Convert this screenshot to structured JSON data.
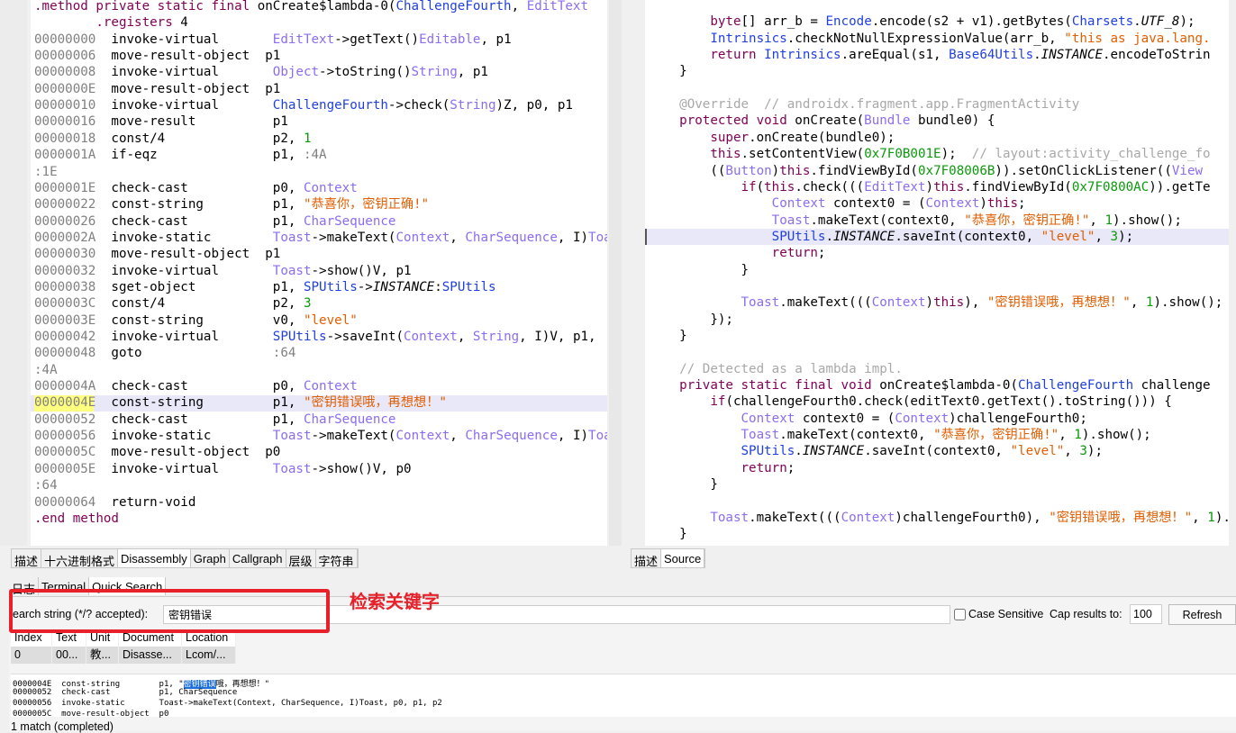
{
  "left_code": [
    [
      [
        ".method private static final ",
        "kw"
      ],
      [
        "onCreate$lambda-0(",
        ""
      ],
      [
        "ChallengeFourth",
        "ty"
      ],
      [
        ", ",
        ""
      ],
      [
        "EditText",
        "ty2"
      ]
    ],
    [
      [
        "        .registers ",
        "kw"
      ],
      [
        "4",
        ""
      ]
    ],
    [
      [
        "00000000  ",
        "addr"
      ],
      [
        "invoke-virtual       ",
        ""
      ],
      [
        "EditText",
        "ty2"
      ],
      [
        "->getText()",
        ""
      ],
      [
        "Editable",
        "ty2"
      ],
      [
        ", p1",
        ""
      ]
    ],
    [
      [
        "00000006  ",
        "addr"
      ],
      [
        "move-result-object  p1",
        ""
      ]
    ],
    [
      [
        "00000008  ",
        "addr"
      ],
      [
        "invoke-virtual       ",
        ""
      ],
      [
        "Object",
        "ty2"
      ],
      [
        "->toString()",
        ""
      ],
      [
        "String",
        "ty2"
      ],
      [
        ", p1",
        ""
      ]
    ],
    [
      [
        "0000000E  ",
        "addr"
      ],
      [
        "move-result-object  p1",
        ""
      ]
    ],
    [
      [
        "00000010  ",
        "addr"
      ],
      [
        "invoke-virtual       ",
        ""
      ],
      [
        "ChallengeFourth",
        "ty"
      ],
      [
        "->check(",
        ""
      ],
      [
        "String",
        "ty2"
      ],
      [
        ")Z, p0, p1",
        ""
      ]
    ],
    [
      [
        "00000016  ",
        "addr"
      ],
      [
        "move-result          p1",
        ""
      ]
    ],
    [
      [
        "00000018  ",
        "addr"
      ],
      [
        "const/4              p2, ",
        ""
      ],
      [
        "1",
        "num"
      ]
    ],
    [
      [
        "0000001A  ",
        "addr"
      ],
      [
        "if-eqz               p1, ",
        ""
      ],
      [
        ":4A",
        "lbl"
      ]
    ],
    [
      [
        ":1E",
        "lbl"
      ]
    ],
    [
      [
        "0000001E  ",
        "addr"
      ],
      [
        "check-cast           p0, ",
        ""
      ],
      [
        "Context",
        "ty2"
      ]
    ],
    [
      [
        "00000022  ",
        "addr"
      ],
      [
        "const-string         p1, ",
        ""
      ],
      [
        "\"恭喜你，密钥正确!\"",
        "str"
      ]
    ],
    [
      [
        "00000026  ",
        "addr"
      ],
      [
        "check-cast           p1, ",
        ""
      ],
      [
        "CharSequence",
        "ty2"
      ]
    ],
    [
      [
        "0000002A  ",
        "addr"
      ],
      [
        "invoke-static        ",
        ""
      ],
      [
        "Toast",
        "ty2"
      ],
      [
        "->makeText(",
        ""
      ],
      [
        "Context",
        "ty2"
      ],
      [
        ", ",
        ""
      ],
      [
        "CharSequence",
        "ty2"
      ],
      [
        ", I)",
        ""
      ],
      [
        "Toast",
        "ty2"
      ]
    ],
    [
      [
        "00000030  ",
        "addr"
      ],
      [
        "move-result-object  p1",
        ""
      ]
    ],
    [
      [
        "00000032  ",
        "addr"
      ],
      [
        "invoke-virtual       ",
        ""
      ],
      [
        "Toast",
        "ty2"
      ],
      [
        "->show()V, p1",
        ""
      ]
    ],
    [
      [
        "00000038  ",
        "addr"
      ],
      [
        "sget-object          p1, ",
        ""
      ],
      [
        "SPUtils",
        "ty"
      ],
      [
        "->",
        ""
      ],
      [
        "INSTANCE",
        "it"
      ],
      [
        ":",
        ""
      ],
      [
        "SPUtils",
        "ty"
      ]
    ],
    [
      [
        "0000003C  ",
        "addr"
      ],
      [
        "const/4              p2, ",
        ""
      ],
      [
        "3",
        "num"
      ]
    ],
    [
      [
        "0000003E  ",
        "addr"
      ],
      [
        "const-string         v0, ",
        ""
      ],
      [
        "\"level\"",
        "str"
      ]
    ],
    [
      [
        "00000042  ",
        "addr"
      ],
      [
        "invoke-virtual       ",
        ""
      ],
      [
        "SPUtils",
        "ty"
      ],
      [
        "->saveInt(",
        ""
      ],
      [
        "Context",
        "ty2"
      ],
      [
        ", ",
        ""
      ],
      [
        "String",
        "ty2"
      ],
      [
        ", I)V, p1,",
        ""
      ]
    ],
    [
      [
        "00000048  ",
        "addr"
      ],
      [
        "goto                 ",
        ""
      ],
      [
        ":64",
        "lbl"
      ]
    ],
    [
      [
        ":4A",
        "lbl"
      ]
    ],
    [
      [
        "0000004A  ",
        "addr"
      ],
      [
        "check-cast           p0, ",
        ""
      ],
      [
        "Context",
        "ty2"
      ]
    ],
    [
      [
        "0000004E  ",
        "addr"
      ],
      [
        "const-string         p1, ",
        ""
      ],
      [
        "\"密钥错误哦，再想想！\"",
        "str"
      ]
    ],
    [
      [
        "00000052  ",
        "addr"
      ],
      [
        "check-cast           p1, ",
        ""
      ],
      [
        "CharSequence",
        "ty2"
      ]
    ],
    [
      [
        "00000056  ",
        "addr"
      ],
      [
        "invoke-static        ",
        ""
      ],
      [
        "Toast",
        "ty2"
      ],
      [
        "->makeText(",
        ""
      ],
      [
        "Context",
        "ty2"
      ],
      [
        ", ",
        ""
      ],
      [
        "CharSequence",
        "ty2"
      ],
      [
        ", I)",
        ""
      ],
      [
        "Toast",
        "ty2"
      ]
    ],
    [
      [
        "0000005C  ",
        "addr"
      ],
      [
        "move-result-object  p0",
        ""
      ]
    ],
    [
      [
        "0000005E  ",
        "addr"
      ],
      [
        "invoke-virtual       ",
        ""
      ],
      [
        "Toast",
        "ty2"
      ],
      [
        "->show()V, p0",
        ""
      ]
    ],
    [
      [
        ":64",
        "lbl"
      ]
    ],
    [
      [
        "00000064  ",
        "addr"
      ],
      [
        "return-void",
        ""
      ]
    ],
    [
      [
        ".end method",
        "kw"
      ]
    ]
  ],
  "right_code": [
    [],
    [
      [
        "        ",
        ""
      ],
      [
        "byte",
        "kw"
      ],
      [
        "[] arr_b = ",
        ""
      ],
      [
        "Encode",
        "ty"
      ],
      [
        ".encode(s2 + v1).getBytes(",
        ""
      ],
      [
        "Charsets",
        "ty"
      ],
      [
        ".",
        ""
      ],
      [
        "UTF_8",
        "it"
      ],
      [
        ");",
        ""
      ]
    ],
    [
      [
        "        ",
        ""
      ],
      [
        "Intrinsics",
        "ty"
      ],
      [
        ".checkNotNullExpressionValue(arr_b, ",
        ""
      ],
      [
        "\"this as java.lang.",
        "str"
      ]
    ],
    [
      [
        "        ",
        ""
      ],
      [
        "return ",
        "kw"
      ],
      [
        "Intrinsics",
        "ty"
      ],
      [
        ".areEqual(s1, ",
        ""
      ],
      [
        "Base64Utils",
        "ty"
      ],
      [
        ".",
        ""
      ],
      [
        "INSTANCE",
        "it"
      ],
      [
        ".encodeToStrin",
        ""
      ]
    ],
    [
      [
        "    }",
        ""
      ]
    ],
    [],
    [
      [
        "    @Override  ",
        "cm"
      ],
      [
        "// androidx.fragment.app.FragmentActivity",
        "cm"
      ]
    ],
    [
      [
        "    ",
        ""
      ],
      [
        "protected void ",
        "kw"
      ],
      [
        "onCreate(",
        ""
      ],
      [
        "Bundle",
        "ty2"
      ],
      [
        " bundle0) {",
        ""
      ]
    ],
    [
      [
        "        ",
        ""
      ],
      [
        "super",
        "kw"
      ],
      [
        ".onCreate(bundle0);",
        ""
      ]
    ],
    [
      [
        "        ",
        ""
      ],
      [
        "this",
        "kw"
      ],
      [
        ".setContentView(",
        ""
      ],
      [
        "0x7F0B001E",
        "num"
      ],
      [
        ");  ",
        ""
      ],
      [
        "// layout:activity_challenge_fo",
        "cm"
      ]
    ],
    [
      [
        "        ((",
        ""
      ],
      [
        "Button",
        "ty2"
      ],
      [
        ")",
        ""
      ],
      [
        "this",
        "kw"
      ],
      [
        ".findViewById(",
        ""
      ],
      [
        "0x7F08006B",
        "num"
      ],
      [
        ")).setOnClickListener((",
        ""
      ],
      [
        "View",
        "ty2"
      ]
    ],
    [
      [
        "            ",
        ""
      ],
      [
        "if",
        "kw"
      ],
      [
        "(",
        ""
      ],
      [
        "this",
        "kw"
      ],
      [
        ".check(((",
        ""
      ],
      [
        "EditText",
        "ty2"
      ],
      [
        ")",
        ""
      ],
      [
        "this",
        "kw"
      ],
      [
        ".findViewById(",
        ""
      ],
      [
        "0x7F0800AC",
        "num"
      ],
      [
        ")).getTe",
        ""
      ]
    ],
    [
      [
        "                ",
        ""
      ],
      [
        "Context",
        "ty2"
      ],
      [
        " context0 = (",
        ""
      ],
      [
        "Context",
        "ty2"
      ],
      [
        ")",
        ""
      ],
      [
        "this",
        "kw"
      ],
      [
        ";",
        ""
      ]
    ],
    [
      [
        "                ",
        ""
      ],
      [
        "Toast",
        "ty2"
      ],
      [
        ".makeText(context0, ",
        ""
      ],
      [
        "\"恭喜你，密钥正确!\"",
        "str"
      ],
      [
        ", ",
        ""
      ],
      [
        "1",
        "num"
      ],
      [
        ").show();",
        ""
      ]
    ],
    [
      [
        "                ",
        ""
      ],
      [
        "SPUtils",
        "ty"
      ],
      [
        ".",
        ""
      ],
      [
        "INSTANCE",
        "it"
      ],
      [
        ".saveInt(context0, ",
        ""
      ],
      [
        "\"level\"",
        "str"
      ],
      [
        ", ",
        ""
      ],
      [
        "3",
        "num"
      ],
      [
        ");",
        ""
      ]
    ],
    [
      [
        "                ",
        ""
      ],
      [
        "return",
        "kw"
      ],
      [
        ";",
        ""
      ]
    ],
    [
      [
        "            }",
        ""
      ]
    ],
    [],
    [
      [
        "            ",
        ""
      ],
      [
        "Toast",
        "ty2"
      ],
      [
        ".makeText(((",
        ""
      ],
      [
        "Context",
        "ty2"
      ],
      [
        ")",
        ""
      ],
      [
        "this",
        "kw"
      ],
      [
        "), ",
        ""
      ],
      [
        "\"密钥错误哦，再想想！\"",
        "str"
      ],
      [
        ", ",
        ""
      ],
      [
        "1",
        "num"
      ],
      [
        ").show();",
        ""
      ]
    ],
    [
      [
        "        });",
        ""
      ]
    ],
    [
      [
        "    }",
        ""
      ]
    ],
    [],
    [
      [
        "    // Detected as a lambda impl.",
        "cm"
      ]
    ],
    [
      [
        "    ",
        ""
      ],
      [
        "private static final void ",
        "kw"
      ],
      [
        "onCreate$lambda-0(",
        ""
      ],
      [
        "ChallengeFourth",
        "ty"
      ],
      [
        " challenge",
        ""
      ]
    ],
    [
      [
        "        ",
        ""
      ],
      [
        "if",
        "kw"
      ],
      [
        "(challengeFourth0.check(editText0.getText().toString())) {",
        ""
      ]
    ],
    [
      [
        "            ",
        ""
      ],
      [
        "Context",
        "ty2"
      ],
      [
        " context0 = (",
        ""
      ],
      [
        "Context",
        "ty2"
      ],
      [
        ")challengeFourth0;",
        ""
      ]
    ],
    [
      [
        "            ",
        ""
      ],
      [
        "Toast",
        "ty2"
      ],
      [
        ".makeText(context0, ",
        ""
      ],
      [
        "\"恭喜你，密钥正确!\"",
        "str"
      ],
      [
        ", ",
        ""
      ],
      [
        "1",
        "num"
      ],
      [
        ").show();",
        ""
      ]
    ],
    [
      [
        "            ",
        ""
      ],
      [
        "SPUtils",
        "ty"
      ],
      [
        ".",
        ""
      ],
      [
        "INSTANCE",
        "it"
      ],
      [
        ".saveInt(context0, ",
        ""
      ],
      [
        "\"level\"",
        "str"
      ],
      [
        ", ",
        ""
      ],
      [
        "3",
        "num"
      ],
      [
        ");",
        ""
      ]
    ],
    [
      [
        "            ",
        ""
      ],
      [
        "return",
        "kw"
      ],
      [
        ";",
        ""
      ]
    ],
    [
      [
        "        }",
        ""
      ]
    ],
    [],
    [
      [
        "        ",
        ""
      ],
      [
        "Toast",
        "ty2"
      ],
      [
        ".makeText(((",
        ""
      ],
      [
        "Context",
        "ty2"
      ],
      [
        ")challengeFourth0), ",
        ""
      ],
      [
        "\"密钥错误哦，再想想！\"",
        "str"
      ],
      [
        ", ",
        ""
      ],
      [
        "1",
        "num"
      ],
      [
        ").",
        ""
      ]
    ],
    [
      [
        "    }",
        ""
      ]
    ]
  ],
  "left_tabs": [
    "描述",
    "十六进制格式",
    "Disassembly",
    "Graph",
    "Callgraph",
    "层级",
    "字符串"
  ],
  "right_tabs": [
    "描述",
    "Source"
  ],
  "bottom_tabs": [
    "日志",
    "Terminal",
    "Quick Search"
  ],
  "search": {
    "label": "earch string (*/? accepted):",
    "value": "密钥错误",
    "case_sensitive_label": "Case Sensitive",
    "case_sensitive": false,
    "cap_label": "Cap results to:",
    "cap_value": "100",
    "refresh_label": "Refresh"
  },
  "results": {
    "headers": [
      "Index",
      "Text",
      "Unit",
      "Document",
      "Location"
    ],
    "rows": [
      [
        "0",
        "00...",
        "教...",
        "Disasse...",
        "Lcom/..."
      ]
    ]
  },
  "preview": [
    [
      "0000004E  const-string        p1, \"",
      "密钥错误",
      "哦，再想想！\""
    ],
    [
      "00000052  check-cast          p1, CharSequence",
      "",
      ""
    ],
    [
      "00000056  invoke-static       Toast->makeText(Context, CharSequence, I)Toast, p0, p1, p2",
      "",
      ""
    ],
    [
      "0000005C  move-result-object  p0",
      "",
      ""
    ]
  ],
  "status": "1 match (completed)",
  "annotation": {
    "text": "检索关键字",
    "color": "#e8202a"
  }
}
